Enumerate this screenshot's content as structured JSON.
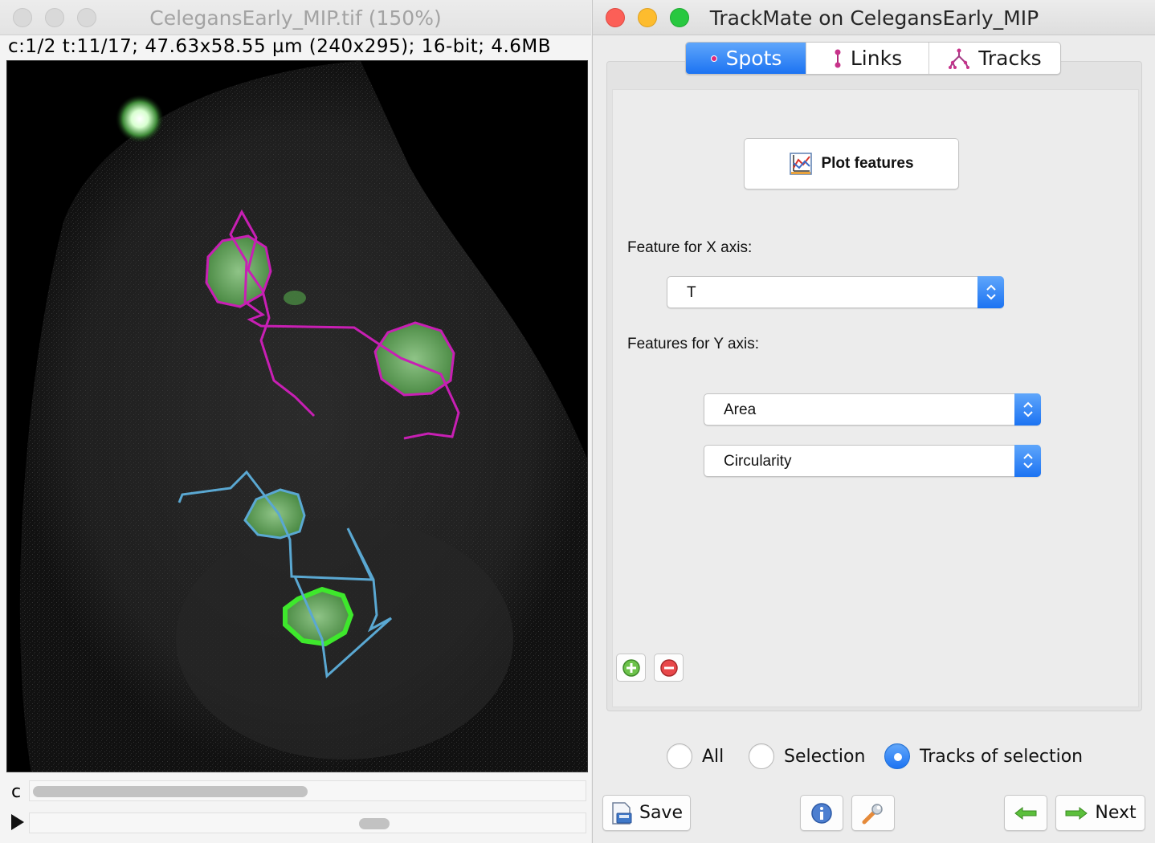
{
  "image_window": {
    "title": "CelegansEarly_MIP.tif (150%)",
    "info": "c:1/2 t:11/17; 47.63x58.55 µm (240x295); 16-bit; 4.6MB",
    "channel_label": "c"
  },
  "trackmate_window": {
    "title": "TrackMate on CelegansEarly_MIP",
    "tabs": [
      {
        "label": "Spots",
        "icon": "spot-icon",
        "active": true
      },
      {
        "label": "Links",
        "icon": "link-icon",
        "active": false
      },
      {
        "label": "Tracks",
        "icon": "tracks-icon",
        "active": false
      }
    ],
    "plot_button": {
      "label": "Plot features",
      "icon": "plot-icon"
    },
    "x_axis": {
      "label": "Feature for X axis:",
      "selected": "T"
    },
    "y_axis": {
      "label": "Features for Y axis:",
      "selected": [
        "Area",
        "Circularity"
      ]
    },
    "radio_options": [
      {
        "label": "All",
        "checked": false
      },
      {
        "label": "Selection",
        "checked": false
      },
      {
        "label": "Tracks of selection",
        "checked": true
      }
    ],
    "buttons": {
      "save": "Save",
      "next": "Next"
    }
  },
  "colors": {
    "accent": "#1c73f2",
    "track_magenta": "#c81fb4",
    "track_cyan": "#5aa8d2",
    "spot_selected": "#3ee82c"
  }
}
